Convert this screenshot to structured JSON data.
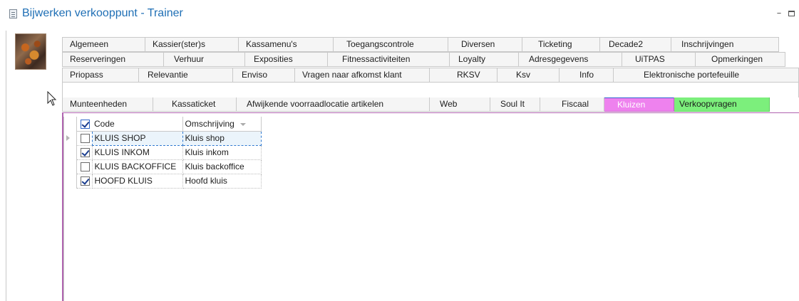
{
  "window": {
    "title": "Bijwerken verkooppunt - Trainer",
    "minimize": "–",
    "close": ":"
  },
  "tabs": {
    "row1": [
      "Algemeen",
      "Kassier(ster)s",
      "Kassamenu's",
      "Toegangscontrole",
      "Diversen",
      "Ticketing",
      "Decade2",
      "Inschrijvingen"
    ],
    "row2": [
      "Reserveringen",
      "Verhuur",
      "Exposities",
      "Fitnessactiviteiten",
      "Loyalty",
      "Adresgegevens",
      "UiTPAS",
      "Opmerkingen"
    ],
    "row3": [
      "Priopass",
      "Relevantie",
      "Enviso",
      "Vragen naar afkomst klant",
      "RKSV",
      "Ksv",
      "Info",
      "Elektronische portefeuille"
    ],
    "row4": [
      "Munteenheden",
      "Kassaticket",
      "Afwijkende voorraadlocatie artikelen",
      "Web",
      "Soul It",
      "Fiscaal",
      "Kluizen",
      "Verkoopvragen"
    ]
  },
  "grid": {
    "header_checked": true,
    "columns": [
      "Code",
      "Omschrijving"
    ],
    "rows": [
      {
        "checked": false,
        "code": "KLUIS SHOP",
        "omschrijving": "Kluis shop"
      },
      {
        "checked": true,
        "code": "KLUIS INKOM",
        "omschrijving": "Kluis inkom"
      },
      {
        "checked": false,
        "code": "KLUIS BACKOFFICE",
        "omschrijving": "Kluis backoffice"
      },
      {
        "checked": true,
        "code": "HOOFD KLUIS",
        "omschrijving": "Hoofd kluis"
      }
    ]
  },
  "colors": {
    "title": "#1f6fb5",
    "tab_kluizen": "#ee82ee",
    "tab_verkoopvragen": "#7cef7c",
    "panel_border": "#b064b0"
  }
}
